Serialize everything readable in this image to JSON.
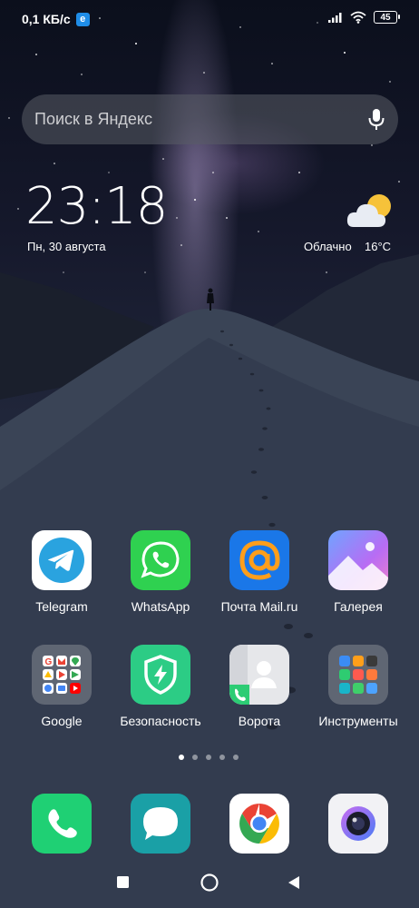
{
  "status_bar": {
    "network_speed": "0,1 КБ/с",
    "carrier_badge": "e",
    "battery": "45",
    "icons": [
      "signal-icon",
      "wifi-icon",
      "battery-icon"
    ]
  },
  "search": {
    "placeholder": "Поиск в Яндекс",
    "icon": "microphone-icon"
  },
  "clock_widget": {
    "time": "23:18",
    "date": "Пн, 30 августа",
    "weather_condition": "Облачно",
    "temperature": "16°C",
    "weather_icon": "partly-cloudy-icon"
  },
  "apps_row1": [
    {
      "label": "Telegram",
      "icon": "telegram-icon"
    },
    {
      "label": "WhatsApp",
      "icon": "whatsapp-icon"
    },
    {
      "label": "Почта Mail.ru",
      "icon": "mail-ru-icon"
    },
    {
      "label": "Галерея",
      "icon": "gallery-icon"
    }
  ],
  "apps_row2": [
    {
      "label": "Google",
      "icon": "google-folder-icon"
    },
    {
      "label": "Безопасность",
      "icon": "security-icon"
    },
    {
      "label": "Ворота",
      "icon": "contacts-gate-icon"
    },
    {
      "label": "Инструменты",
      "icon": "tools-folder-icon"
    }
  ],
  "dock": [
    {
      "icon": "phone-icon"
    },
    {
      "icon": "messages-icon"
    },
    {
      "icon": "chrome-icon"
    },
    {
      "icon": "camera-icon"
    }
  ],
  "page_indicator": {
    "pages": 5,
    "current": 1
  },
  "navigation": [
    "recents-button",
    "home-button",
    "back-button"
  ],
  "colors": {
    "telegram": "#2aa3df",
    "whatsapp": "#2fd150",
    "mail": "#1a77e8",
    "security": "#2ccc85",
    "phone": "#1fd074",
    "messages": "#1aa0a6",
    "carrier_badge": "#1f8de8"
  }
}
